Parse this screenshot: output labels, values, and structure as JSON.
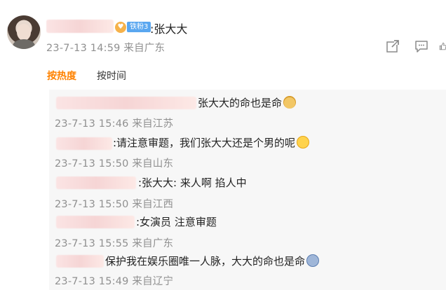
{
  "comment": {
    "badge_label": "铁粉3",
    "text": ":张大大",
    "meta": "23-7-13 14:59 来自广东"
  },
  "actions": {
    "share_icon": "share-icon",
    "comment_icon": "comment-icon",
    "like_icon": "like-icon"
  },
  "sort_tabs": {
    "hot": "按热度",
    "time": "按时间"
  },
  "colors": {
    "active_tab": "#ff8200",
    "badge": "#5aa7f0",
    "meta": "#909090",
    "reply_bg": "#f7f7f7"
  },
  "replies": [
    {
      "text": "张大大的命也是命",
      "emoji": "doge-emoji",
      "meta": "23-7-13 15:46 来自江苏"
    },
    {
      "text": ":请注意审题，我们张大大还是个男的呢",
      "emoji": "laugh-emoji",
      "meta": "23-7-13 15:50 来自山东"
    },
    {
      "text": ":张大大: 来人啊 掐人中",
      "emoji": "",
      "meta": "23-7-13 15:50 来自江西"
    },
    {
      "text": ":女演员 注意审题",
      "emoji": "",
      "meta": "23-7-13 15:55 来自广东"
    },
    {
      "text": "保护我在娱乐圈唯一人脉，大大的命也是命",
      "emoji": "scream-emoji",
      "meta": "23-7-13 15:49 来自辽宁"
    }
  ]
}
